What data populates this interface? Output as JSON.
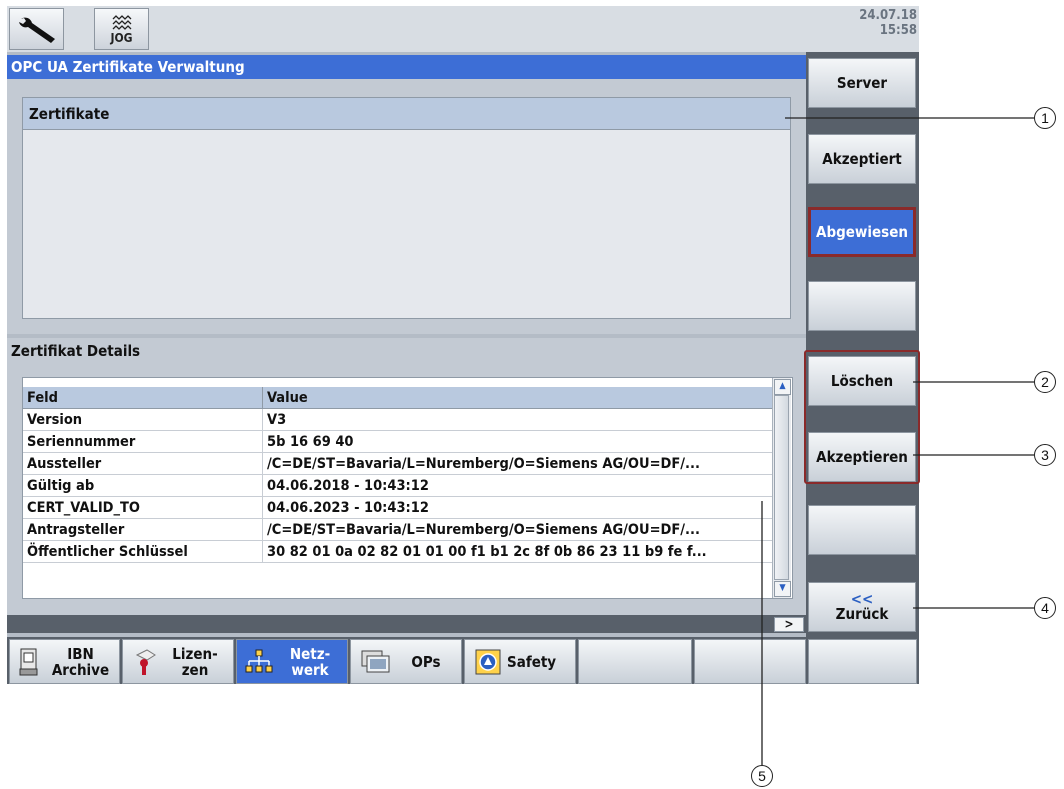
{
  "topbar": {
    "jog_label": "JOG",
    "date": "24.07.18",
    "time": "15:58"
  },
  "title": "OPC UA Zertifikate Verwaltung",
  "certificates": {
    "header": "Zertifikate"
  },
  "details": {
    "heading": "Zertifikat Details",
    "columns": [
      "Feld",
      "Value"
    ],
    "rows": [
      [
        "Version",
        "V3"
      ],
      [
        "Seriennummer",
        "5b 16 69 40"
      ],
      [
        "Aussteller",
        "/C=DE/ST=Bavaria/L=Nuremberg/O=Siemens AG/OU=DF/..."
      ],
      [
        "Gültig ab",
        "04.06.2018 - 10:43:12"
      ],
      [
        "CERT_VALID_TO",
        "04.06.2023 - 10:43:12"
      ],
      [
        "Antragsteller",
        "/C=DE/ST=Bavaria/L=Nuremberg/O=Siemens AG/OU=DF/..."
      ],
      [
        "Öffentlicher Schlüssel",
        "30 82 01 0a 02 82 01 01 00 f1 b1 2c 8f 0b 86 23 11 b9 fe f..."
      ]
    ]
  },
  "right_softkeys": {
    "server": "Server",
    "akzeptiert": "Akzeptiert",
    "abgewiesen": "Abgewiesen",
    "loeschen": "Löschen",
    "akzeptieren": "Akzeptieren",
    "zurueck_arrow": "<<",
    "zurueck": "Zurück"
  },
  "bottom_softkeys": {
    "ibn_archive": [
      "IBN",
      "Archive"
    ],
    "lizenzen": [
      "Lizen-",
      "zen"
    ],
    "netzwerk": [
      "Netz-",
      "werk"
    ],
    "ops": "OPs",
    "safety": "Safety"
  },
  "callouts": [
    "1",
    "2",
    "3",
    "4",
    "5"
  ],
  "colors": {
    "accent": "#3d6ed6",
    "highlight_frame": "#8a2a2a"
  }
}
